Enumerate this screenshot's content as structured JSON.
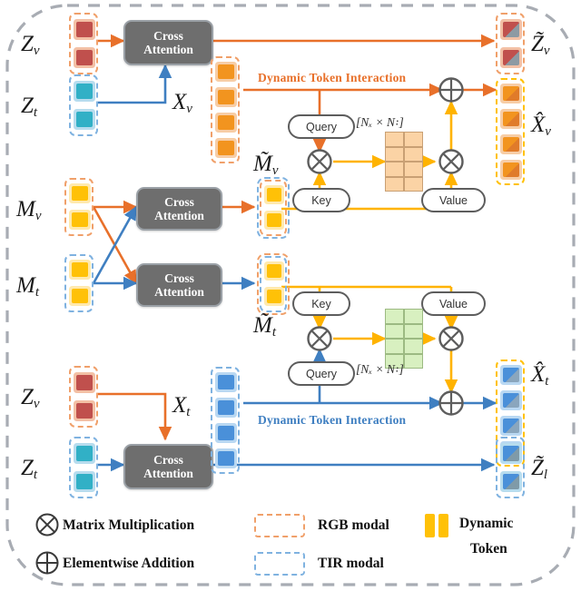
{
  "figure": {
    "title": "Dynamic Token Interaction cross-modal attention architecture",
    "container_border_color": "#a8acb3"
  },
  "colors": {
    "orange_accent": "#e8702a",
    "blue_accent": "#3f7fc1",
    "yellow_accent": "#ffc107",
    "gray_box": "#6e6e6e",
    "rgb_dash": "#f0a06a",
    "tir_dash": "#7fb2e0",
    "matrix_orange": "#fbd3a5",
    "matrix_green": "#d8f0c0",
    "token_red": "#c0504d",
    "token_teal": "#31b0c6",
    "token_orange": "#f2941f",
    "token_blue": "#4a90d9"
  },
  "inputs": {
    "zv_top": "Z",
    "zv_top_sub": "v",
    "zt_top": "Z",
    "zt_top_sub": "t",
    "mv": "M",
    "mv_sub": "v",
    "mt": "M",
    "mt_sub": "t",
    "zv_bottom": "Z",
    "zv_bottom_sub": "v",
    "zt_bottom": "Z",
    "zt_bottom_sub": "t"
  },
  "intermediates": {
    "xv": "X",
    "xv_sub": "v",
    "xt": "X",
    "xt_sub": "t",
    "mv_tilde": "M̃",
    "mv_tilde_sub": "v",
    "mt_tilde": "M̃",
    "mt_tilde_sub": "t"
  },
  "outputs": {
    "zv_tilde": "Z̃",
    "zv_tilde_sub": "v",
    "xv_hat": "X̂",
    "xv_hat_sub": "v",
    "xt_hat": "X̂",
    "xt_hat_sub": "t",
    "zl_tilde": "Z̃",
    "zl_tilde_sub": "l"
  },
  "blocks": {
    "cross_attention": {
      "line1": "Cross",
      "line2": "Attention"
    },
    "count": 4
  },
  "attention_top": {
    "query_label": "Query",
    "key_label": "Key",
    "value_label": "Value",
    "matmul_symbol": "⊗",
    "add_symbol": "⊕",
    "matrix_shape_label": "[Nₓ × N꞉]",
    "matrix_rows": 4,
    "matrix_cols": 2,
    "matrix_color": "orange",
    "interaction_label": "Dynamic Token Interaction"
  },
  "attention_bottom": {
    "query_label": "Query",
    "key_label": "Key",
    "value_label": "Value",
    "matmul_symbol": "⊗",
    "add_symbol": "⊕",
    "matrix_shape_label": "[Nₓ × N꞉]",
    "matrix_rows": 4,
    "matrix_cols": 2,
    "matrix_color": "green",
    "interaction_label": "Dynamic Token Interaction"
  },
  "legend": {
    "items": [
      {
        "symbol": "⊗",
        "label": "Matrix Multiplication"
      },
      {
        "symbol": "⊕",
        "label": "Elementwise Addition"
      },
      {
        "symbol": "dashed-orange-box",
        "label": "RGB modal"
      },
      {
        "symbol": "dashed-blue-box",
        "label": "TIR  modal"
      },
      {
        "symbol": "yellow-token-pair",
        "label": "Dynamic Token"
      }
    ],
    "dynamic_token_line1": "Dynamic",
    "dynamic_token_line2": "Token"
  }
}
